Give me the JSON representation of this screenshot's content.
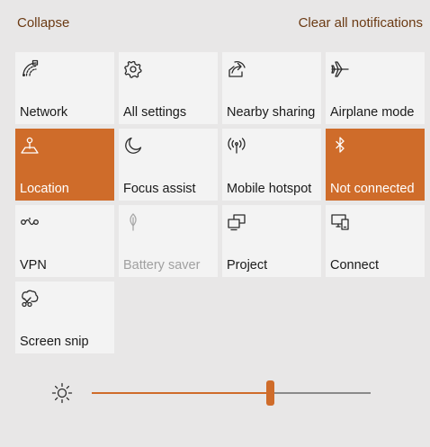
{
  "header": {
    "collapse_label": "Collapse",
    "clear_all_label": "Clear all notifications"
  },
  "tiles": [
    {
      "label": "Network",
      "icon": "network-icon",
      "active": false,
      "disabled": false
    },
    {
      "label": "All settings",
      "icon": "gear-icon",
      "active": false,
      "disabled": false
    },
    {
      "label": "Nearby sharing",
      "icon": "share-icon",
      "active": false,
      "disabled": false
    },
    {
      "label": "Airplane mode",
      "icon": "airplane-icon",
      "active": false,
      "disabled": false
    },
    {
      "label": "Location",
      "icon": "location-icon",
      "active": true,
      "disabled": false
    },
    {
      "label": "Focus assist",
      "icon": "moon-icon",
      "active": false,
      "disabled": false
    },
    {
      "label": "Mobile hotspot",
      "icon": "hotspot-icon",
      "active": false,
      "disabled": false
    },
    {
      "label": "Not connected",
      "icon": "bluetooth-icon",
      "active": true,
      "disabled": false
    },
    {
      "label": "VPN",
      "icon": "vpn-icon",
      "active": false,
      "disabled": false
    },
    {
      "label": "Battery saver",
      "icon": "leaf-icon",
      "active": false,
      "disabled": true
    },
    {
      "label": "Project",
      "icon": "project-icon",
      "active": false,
      "disabled": false
    },
    {
      "label": "Connect",
      "icon": "connect-icon",
      "active": false,
      "disabled": false
    },
    {
      "label": "Screen snip",
      "icon": "screen-snip-icon",
      "active": false,
      "disabled": false
    }
  ],
  "brightness": {
    "icon": "brightness-icon",
    "level_percent": 64
  },
  "colors": {
    "accent": "#cf6c2a",
    "background": "#e8e7e7",
    "tile": "#f3f3f3",
    "link": "#6b3a13"
  }
}
